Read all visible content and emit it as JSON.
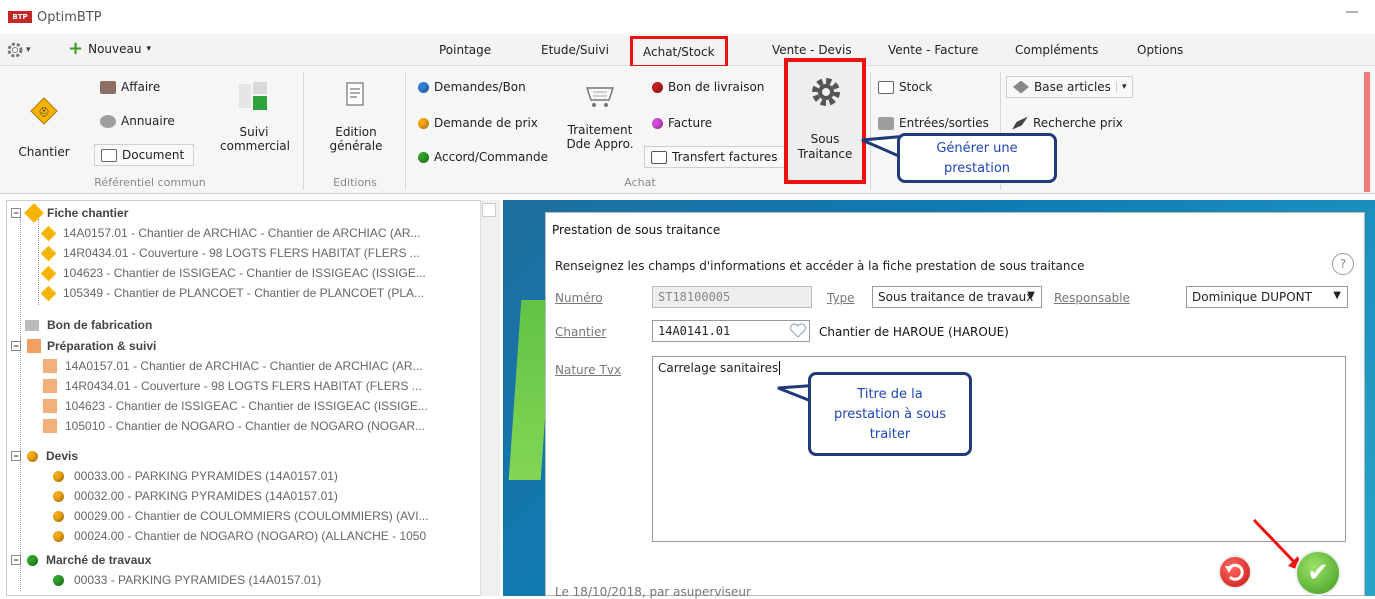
{
  "app": {
    "title": "OptimBTP",
    "logo_text": "BTP",
    "minimize": "—"
  },
  "toolbar": {
    "nouveau_label": "Nouveau"
  },
  "menu": {
    "items": [
      "Pointage",
      "Etude/Suivi",
      "Achat/Stock",
      "Vente - Devis",
      "Vente - Facture",
      "Compléments",
      "Options"
    ],
    "active_index": 2
  },
  "ribbon": {
    "referentiel": {
      "chantier": "Chantier",
      "affaire": "Affaire",
      "annuaire": "Annuaire",
      "document": "Document",
      "suivi_line1": "Suivi",
      "suivi_line2": "commercial",
      "label": "Référentiel commun"
    },
    "editions": {
      "edition_line1": "Edition",
      "edition_line2": "générale",
      "label": "Editions"
    },
    "achat": {
      "demandes_bon": "Demandes/Bon",
      "demande_prix": "Demande de prix",
      "accord_commande": "Accord/Commande",
      "traitement_line1": "Traitement",
      "traitement_line2": "Dde Appro.",
      "bon_livraison": "Bon de livraison",
      "facture": "Facture",
      "transfert": "Transfert factures",
      "sous_line1": "Sous",
      "sous_line2": "Traitance",
      "label": "Achat"
    },
    "stock": {
      "stock": "Stock",
      "entrees": "Entrées/sorties"
    },
    "articles": {
      "base": "Base articles",
      "recherche": "Recherche prix"
    }
  },
  "callouts": {
    "generer": {
      "line1": "Générer une",
      "line2": "prestation"
    },
    "titre": {
      "line1": "Titre de la",
      "line2": "prestation à sous",
      "line3": "traiter"
    }
  },
  "tree": {
    "fiche_chantier": {
      "label": "Fiche chantier",
      "items": [
        "14A0157.01 - Chantier de ARCHIAC - Chantier de ARCHIAC (AR...",
        "14R0434.01 - Couverture - 98 LOGTS FLERS HABITAT (FLERS ...",
        "104623 - Chantier de ISSIGEAC - Chantier de ISSIGEAC (ISSIGE...",
        "105349 - Chantier de PLANCOET - Chantier de PLANCOET (PLA..."
      ]
    },
    "bon_fabrication": {
      "label": "Bon de fabrication"
    },
    "preparation": {
      "label": "Préparation & suivi",
      "items": [
        "14A0157.01 - Chantier de ARCHIAC - Chantier de ARCHIAC (AR...",
        "14R0434.01 - Couverture - 98 LOGTS FLERS HABITAT (FLERS ...",
        "104623 - Chantier de ISSIGEAC - Chantier de ISSIGEAC (ISSIGE...",
        "105010 - Chantier de NOGARO - Chantier de NOGARO (NOGAR..."
      ]
    },
    "devis": {
      "label": "Devis",
      "items": [
        "00033.00 - PARKING PYRAMIDES  (14A0157.01)",
        "00032.00 - PARKING PYRAMIDES  (14A0157.01)",
        "00029.00 - Chantier de COULOMMIERS (COULOMMIERS) (AVI...",
        "00024.00 - Chantier de NOGARO (NOGARO) (ALLANCHE - 1050"
      ]
    },
    "marche": {
      "label": "Marché de travaux",
      "items": [
        "00033 - PARKING PYRAMIDES  (14A0157.01)"
      ]
    }
  },
  "dialog": {
    "title": "Prestation de sous traitance",
    "subtitle": "Renseignez les champs d'informations et accéder à la fiche prestation de sous traitance",
    "help": "?",
    "numero_label": "Numéro",
    "numero_value": "ST18100005",
    "type_label": "Type",
    "type_value": "Sous traitance de travaux",
    "responsable_label": "Responsable",
    "responsable_value": "Dominique DUPONT",
    "chantier_label": "Chantier",
    "chantier_value": "14A0141.01",
    "chantier_name": "Chantier de HAROUE (HAROUE)",
    "nature_label": "Nature Tvx",
    "nature_value": "Carrelage sanitaires",
    "footer": "Le 18/10/2018, par asuperviseur"
  },
  "colors": {
    "highlight": "#ee1111",
    "callout_border": "#233a7a",
    "callout_text": "#1e46b4",
    "arrow": "#e11"
  }
}
